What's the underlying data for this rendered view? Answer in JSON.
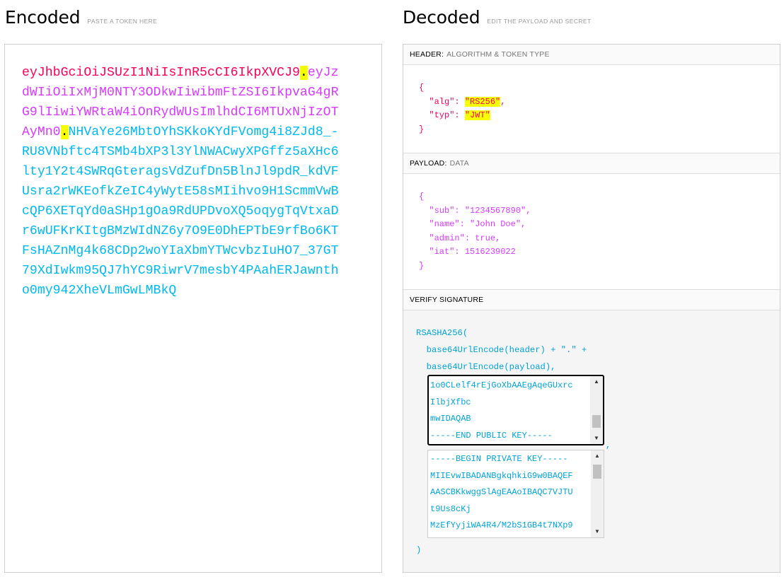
{
  "encoded": {
    "title": "Encoded",
    "subtitle": "PASTE A TOKEN HERE",
    "token": {
      "header": "eyJhbGciOiJSUzI1NiIsInR5cCI6IkpXVCJ9",
      "payload": "eyJzdWIiOiIxMjM0NTY3ODkwIiwibmFtZSI6IkpvaG4gRG9lIiwiYWRtaW4iOnRydWUsImlhdCI6MTUxNjIzOTAyMn0",
      "signature": "NHVaYe26MbtOYhSKkoKYdFVomg4i8ZJd8_-RU8VNbftc4TSMb4bXP3l3YlNWACwyXPGffz5aXHc6lty1Y2t4SWRqGteragsVdZufDn5BlnJl9pdR_kdVFUsra2rWKEofkZeIC4yWytE58sMIihvo9H1ScmmVwBcQP6XETqYd0aSHp1gOa9RdUPDvoXQ5oqygTqVtxaDr6wUFKrKItgBMzWIdNZ6y7O9E0DhEPTbE9rfBo6KTFsHAZnMg4k68CDp2woYIaXbmYTWcvbzIuHO7_37GT79XdIwkm95QJ7hYC9RiwrV7mesbY4PAahERJawntho0my942XheVLmGwLMBkQ"
    }
  },
  "decoded": {
    "title": "Decoded",
    "subtitle": "EDIT THE PAYLOAD AND SECRET",
    "header_section": {
      "label": "HEADER:",
      "hint": "ALGORITHM & TOKEN TYPE"
    },
    "payload_section": {
      "label": "PAYLOAD:",
      "hint": "DATA"
    },
    "verify_section": {
      "label": "VERIFY SIGNATURE"
    },
    "header_json": {
      "open": "{",
      "alg_key": "\"alg\"",
      "alg_value": "\"RS256\"",
      "typ_key": "\"typ\"",
      "typ_value": "\"JWT\"",
      "close": "}"
    },
    "payload_json": {
      "open": "{",
      "sub_line": "\"sub\": \"1234567890\",",
      "name_line": "\"name\": \"John Doe\",",
      "admin_line": "\"admin\": true,",
      "iat_line": "\"iat\": 1516239022",
      "close": "}"
    },
    "verify": {
      "line1": "RSASHA256(",
      "line2": "base64UrlEncode(header) + \".\" +",
      "line3": "base64UrlEncode(payload),",
      "close": ")",
      "public_key_lines": [
        "1o0CLelf4rEjGoXbAAEgAqeGUxrc",
        "IlbjXfbc",
        "mwIDAQAB",
        "-----END PUBLIC KEY-----"
      ],
      "private_key_lines": [
        "-----BEGIN PRIVATE KEY-----",
        "MIIEvwIBADANBgkqhkiG9w0BAQEF",
        "AASCBKkwggSlAgEAAoIBAQC7VJTU",
        "t9Us8cKj",
        "MzEfYyjiWA4R4/M2bS1GB4t7NXp9"
      ]
    }
  }
}
